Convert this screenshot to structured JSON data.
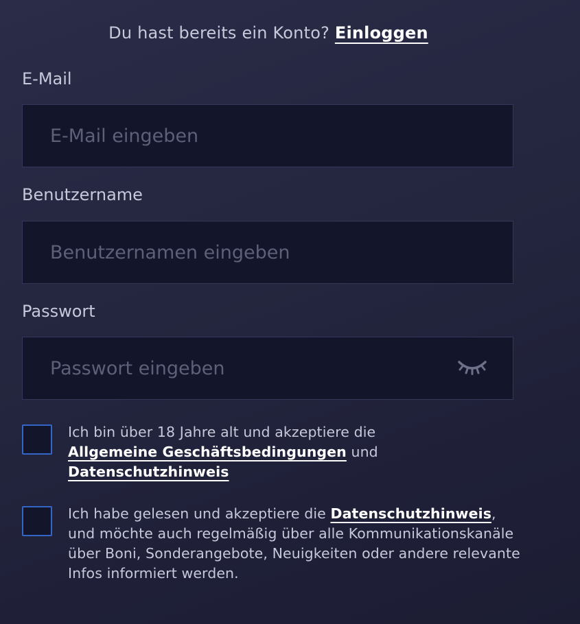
{
  "login_prompt": {
    "text": "Du hast bereits ein Konto?",
    "link": "Einloggen"
  },
  "email": {
    "label": "E-Mail",
    "placeholder": "E-Mail eingeben",
    "value": ""
  },
  "username": {
    "label": "Benutzername",
    "placeholder": "Benutzernamen eingeben",
    "value": ""
  },
  "password": {
    "label": "Passwort",
    "placeholder": "Passwort eingeben",
    "value": "",
    "toggle_icon": "eye-closed-icon"
  },
  "consent_terms": {
    "checked": false,
    "text_before": "Ich bin über 18 Jahre alt und akzeptiere die",
    "terms_link": "Allgemeine Geschäftsbedingungen",
    "conjunction": "und",
    "privacy_link": "Datenschutzhinweis"
  },
  "consent_marketing": {
    "checked": false,
    "text_before": "Ich habe gelesen und akzeptiere die",
    "privacy_link": "Datenschutzhinweis",
    "text_after": ", und möchte auch regelmäßig über alle Kommunikationskanäle über Boni, Sonderangebote, Neuigkeiten oder andere relevante Infos informiert werden."
  },
  "colors": {
    "background": "#25273f",
    "input_background": "#13152a",
    "checkbox_border": "#3466c8",
    "link": "#ffffff",
    "text": "#c6c9da",
    "placeholder": "#5c6078"
  }
}
